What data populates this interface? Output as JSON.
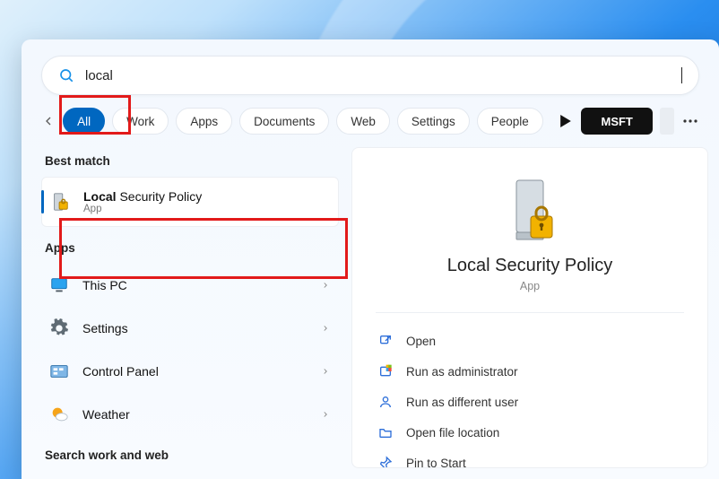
{
  "search": {
    "query": "local"
  },
  "filters": {
    "items": [
      {
        "key": "all",
        "label": "All",
        "active": true
      },
      {
        "key": "work",
        "label": "Work"
      },
      {
        "key": "apps",
        "label": "Apps"
      },
      {
        "key": "documents",
        "label": "Documents"
      },
      {
        "key": "web",
        "label": "Web"
      },
      {
        "key": "settings",
        "label": "Settings"
      },
      {
        "key": "people",
        "label": "People"
      }
    ],
    "msft_label": "MSFT"
  },
  "left_panel": {
    "best_match_header": "Best match",
    "best_match": {
      "title_bold": "Local",
      "title_rest": " Security Policy",
      "subtitle": "App"
    },
    "apps_header": "Apps",
    "apps": [
      {
        "icon": "monitor",
        "label": "This PC"
      },
      {
        "icon": "gear",
        "label": "Settings"
      },
      {
        "icon": "panel",
        "label": "Control Panel"
      },
      {
        "icon": "weather",
        "label": "Weather"
      }
    ],
    "search_work_web": "Search work and web"
  },
  "detail": {
    "title": "Local Security Policy",
    "subtitle": "App",
    "actions": [
      {
        "icon": "open",
        "label": "Open"
      },
      {
        "icon": "shield",
        "label": "Run as administrator"
      },
      {
        "icon": "user",
        "label": "Run as different user"
      },
      {
        "icon": "folder",
        "label": "Open file location"
      },
      {
        "icon": "pin",
        "label": "Pin to Start"
      }
    ]
  }
}
